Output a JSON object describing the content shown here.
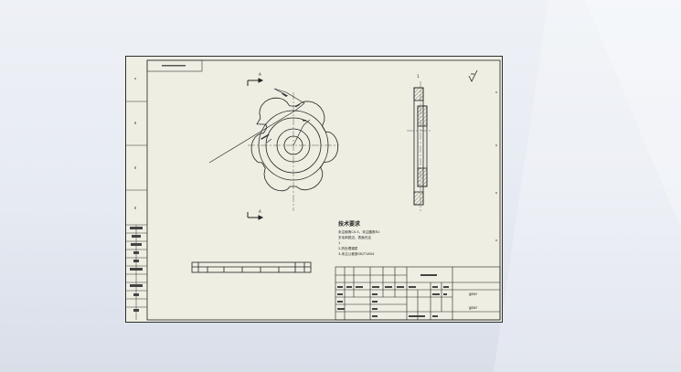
{
  "drawing": {
    "section_mark": "1",
    "tech_notes": {
      "title": "技术要求",
      "lines": [
        "未注倒角C0.5，未注圆角R1",
        "去毛刺锐边，表面光洁",
        "1",
        "2.热处理调质",
        "3.未注公差按GB/T1804"
      ]
    },
    "title_block": {
      "part_name": "",
      "drawing_no_1": "gear",
      "drawing_no_2": "gear",
      "scale_label": "比例",
      "sheet_label": "第1页"
    }
  }
}
